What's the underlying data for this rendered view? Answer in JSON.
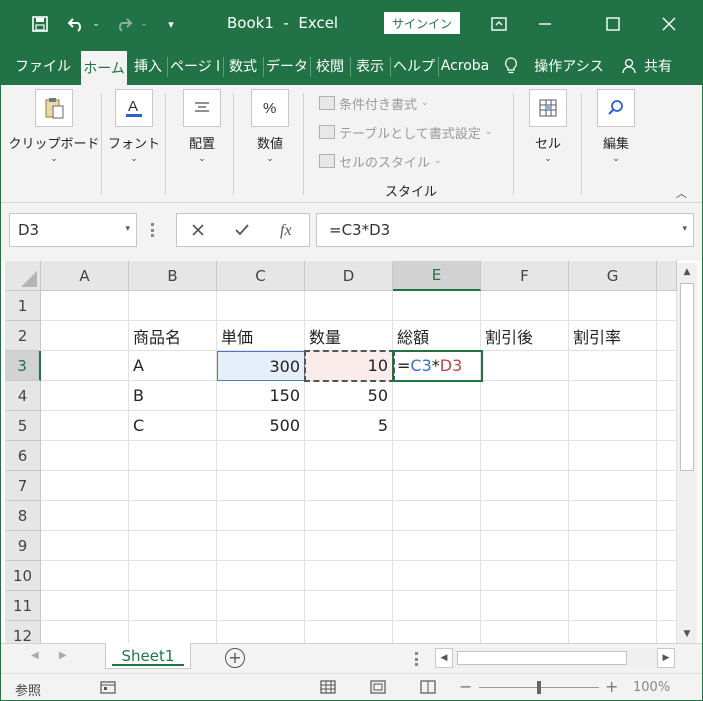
{
  "window": {
    "title": "Book1  -  Excel",
    "signin_label": "サインイン",
    "accent": "#217346"
  },
  "tabs": [
    {
      "label": "ファイル"
    },
    {
      "label": "ホーム",
      "active": true
    },
    {
      "label": "挿入"
    },
    {
      "label": "ページ l"
    },
    {
      "label": "数式"
    },
    {
      "label": "データ"
    },
    {
      "label": "校閲"
    },
    {
      "label": "表示"
    },
    {
      "label": "ヘルプ"
    },
    {
      "label": "Acroba"
    },
    {
      "label": "操作アシス"
    },
    {
      "label": "共有"
    }
  ],
  "ribbon": {
    "clipboard_label": "クリップボード",
    "font_label": "フォント",
    "alignment_label": "配置",
    "number_label": "数値",
    "conditional_format_label": "条件付き書式",
    "format_as_table_label": "テーブルとして書式設定",
    "cell_styles_label": "セルのスタイル",
    "styles_group_label": "スタイル",
    "cells_label": "セル",
    "editing_label": "編集"
  },
  "formula_bar": {
    "name_box": "D3",
    "formula": "=C3*D3"
  },
  "columns": [
    "A",
    "B",
    "C",
    "D",
    "E",
    "F",
    "G"
  ],
  "rows": [
    "1",
    "2",
    "3",
    "4",
    "5",
    "6",
    "7",
    "8",
    "9",
    "10",
    "11",
    "12"
  ],
  "cells": {
    "B2": "商品名",
    "C2": "単価",
    "D2": "数量",
    "E2": "総額",
    "F2": "割引後",
    "G2": "割引率",
    "B3": "A",
    "C3": "300",
    "D3": "10",
    "B4": "B",
    "C4": "150",
    "D4": "50",
    "B5": "C",
    "C5": "500",
    "D5": "5"
  },
  "editing_formula": {
    "eq": "=",
    "ref1": "C3",
    "op": "*",
    "ref2": "D3"
  },
  "sheet": {
    "tab_label": "Sheet1"
  },
  "status": {
    "mode": "参照",
    "zoom": "100%"
  }
}
